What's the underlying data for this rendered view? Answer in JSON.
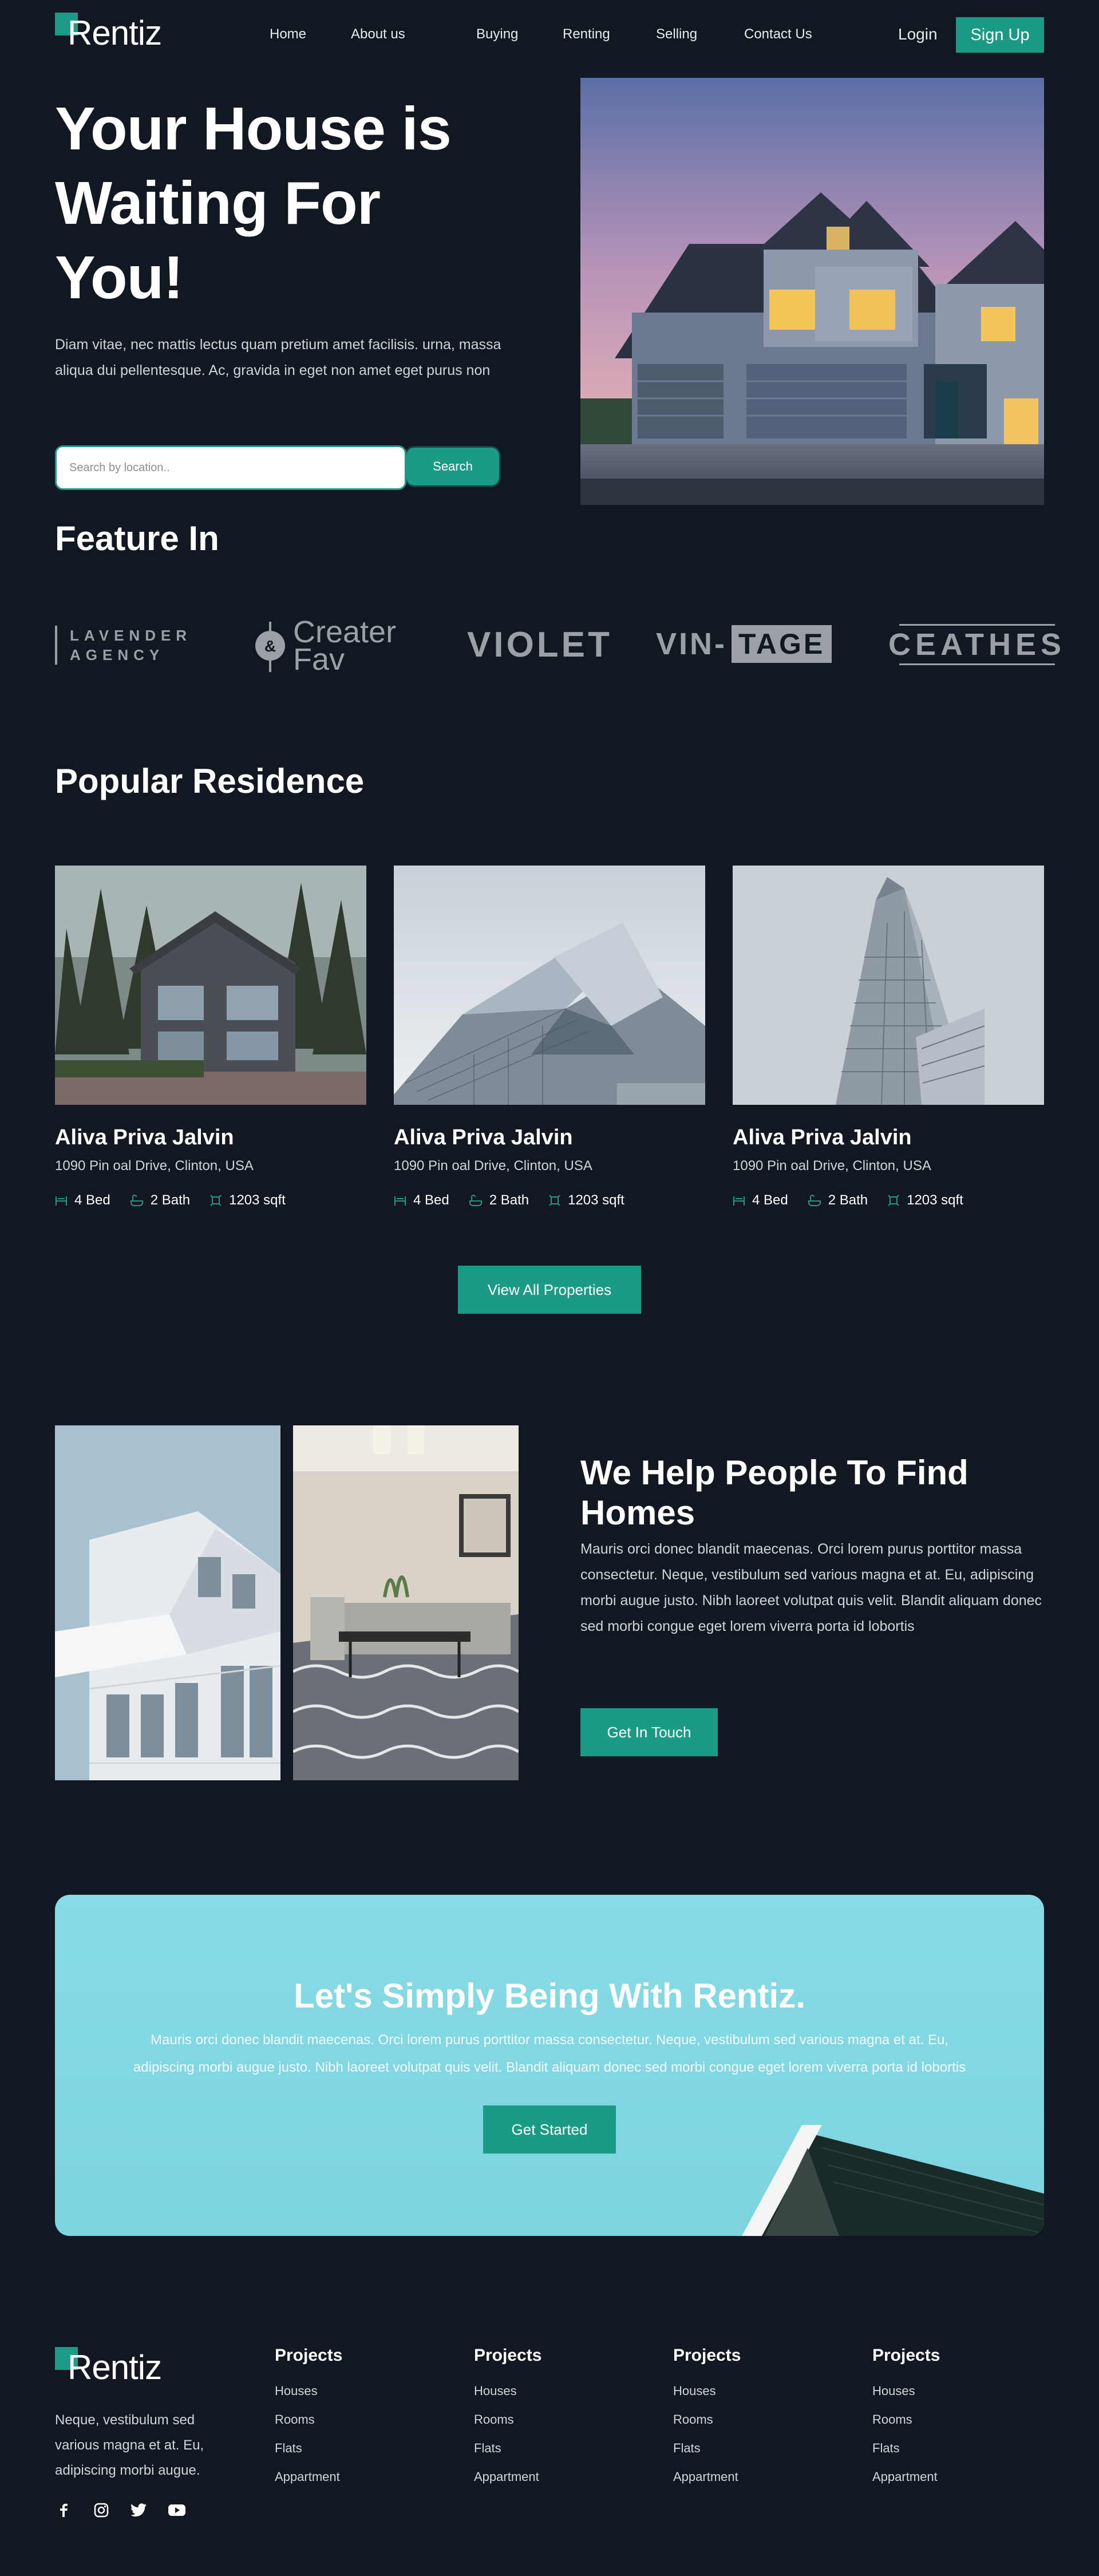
{
  "nav": {
    "brand": "Rentiz",
    "links": [
      "Home",
      "About us",
      "Buying",
      "Renting",
      "Selling",
      "Contact Us"
    ],
    "login": "Login",
    "signup": "Sign Up"
  },
  "hero": {
    "title_line1": "Your House is",
    "title_line2": "Waiting For",
    "title_line3": "You!",
    "subtitle": "Diam vitae, nec mattis lectus quam pretium amet facilisis. urna, massa aliqua dui pellentesque. Ac, gravida in eget non amet eget purus non",
    "search_placeholder": "Search by location..",
    "search_button": "Search"
  },
  "featured": {
    "title": "Feature In",
    "brands": {
      "lavender_line1": "LAVENDER",
      "lavender_line2": "AGENCY",
      "creater_line1": "Creater",
      "creater_line2": "Fav",
      "violet": "VIOLET",
      "vintage_left": "VIN-",
      "vintage_right": "TAGE",
      "ceathes": "CEATHES"
    }
  },
  "popular": {
    "title": "Popular Residence",
    "cards": [
      {
        "name": "Aliva Priva Jalvin",
        "address": "1090 Pin oal Drive, Clinton, USA",
        "bed": "4 Bed",
        "bath": "2 Bath",
        "area": "1203 sqft"
      },
      {
        "name": "Aliva Priva Jalvin",
        "address": "1090 Pin oal Drive, Clinton, USA",
        "bed": "4 Bed",
        "bath": "2 Bath",
        "area": "1203 sqft"
      },
      {
        "name": "Aliva Priva Jalvin",
        "address": "1090 Pin oal Drive, Clinton, USA",
        "bed": "4 Bed",
        "bath": "2 Bath",
        "area": "1203 sqft"
      }
    ],
    "view_all": "View All Properties"
  },
  "help": {
    "title_line1": "We Help People To Find",
    "title_line2": "Homes",
    "text": "Mauris orci donec blandit maecenas. Orci lorem purus porttitor massa consectetur. Neque, vestibulum sed various magna et at. Eu, adipiscing morbi augue justo. Nibh laoreet volutpat quis velit. Blandit aliquam donec sed morbi congue eget lorem viverra porta id lobortis",
    "button": "Get In Touch"
  },
  "cta": {
    "title": "Let's Simply Being With Rentiz.",
    "text_line1": "Mauris orci donec blandit maecenas. Orci lorem purus porttitor massa consectetur. Neque, vestibulum sed various magna et at. Eu,",
    "text_line2": "adipiscing morbi augue justo. Nibh laoreet volutpat quis velit. Blandit aliquam donec sed morbi congue eget lorem viverra porta id lobortis",
    "button": "Get Started"
  },
  "footer": {
    "brand": "Rentiz",
    "about": "Neque, vestibulum sed various magna et at. Eu, adipiscing morbi augue.",
    "columns": [
      {
        "title": "Projects",
        "items": [
          "Houses",
          "Rooms",
          "Flats",
          "Appartment"
        ]
      },
      {
        "title": "Projects",
        "items": [
          "Houses",
          "Rooms",
          "Flats",
          "Appartment"
        ]
      },
      {
        "title": "Projects",
        "items": [
          "Houses",
          "Rooms",
          "Flats",
          "Appartment"
        ]
      },
      {
        "title": "Projects",
        "items": [
          "Houses",
          "Rooms",
          "Flats",
          "Appartment"
        ]
      }
    ],
    "social": [
      "facebook-icon",
      "instagram-icon",
      "twitter-icon",
      "youtube-icon"
    ]
  },
  "colors": {
    "background": "#111821",
    "accent": "#1b9b86",
    "cta_background": "#7fd6e1"
  }
}
